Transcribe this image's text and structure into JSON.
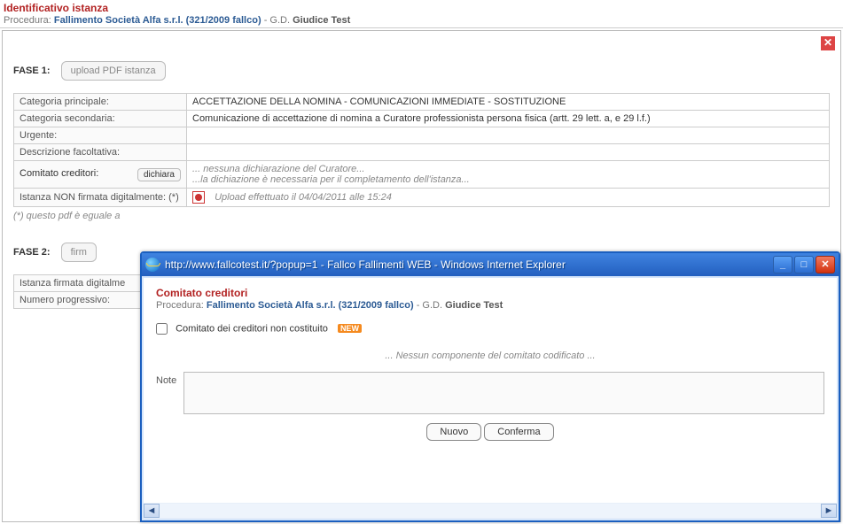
{
  "header": {
    "title": "Identificativo istanza",
    "proc_label": "Procedura:",
    "proc_value": "Fallimento Società Alfa s.r.l. (321/2009 fallco)",
    "gd_label": "- G.D.",
    "gd_value": "Giudice Test"
  },
  "fase1": {
    "label": "FASE 1:",
    "button": "upload PDF istanza"
  },
  "rows": {
    "cat_princ_lab": "Categoria principale:",
    "cat_princ_val": "ACCETTAZIONE DELLA NOMINA - COMUNICAZIONI IMMEDIATE - SOSTITUZIONE",
    "cat_sec_lab": "Categoria secondaria:",
    "cat_sec_val": "Comunicazione di accettazione di nomina a Curatore professionista persona fisica (artt. 29 lett. a, e 29 l.f.)",
    "urgente_lab": "Urgente:",
    "urgente_val": "",
    "descr_lab": "Descrizione facoltativa:",
    "descr_val": "",
    "comitato_lab": "Comitato creditori:",
    "comitato_btn": "dichiara",
    "comitato_txt1": "... nessuna dichiarazione del Curatore...",
    "comitato_txt2": "...la dichiazione è necessaria per il completamento dell'istanza...",
    "istanza_lab": "Istanza NON firmata digitalmente: (*)",
    "istanza_txt": "Upload effettuato il   04/04/2011 alle 15:24",
    "footnote": "(*) questo pdf è eguale a"
  },
  "fase2": {
    "label": "FASE 2:",
    "button": "firm"
  },
  "rows2": {
    "r1_lab": "Istanza firmata digitalme",
    "r2_lab": "Numero progressivo:"
  },
  "popup": {
    "title": "http://www.fallcotest.it/?popup=1 - Fallco Fallimenti WEB - Windows Internet Explorer",
    "section_title": "Comitato creditori",
    "proc_label": "Procedura:",
    "proc_value": "Fallimento Società Alfa s.r.l. (321/2009 fallco)",
    "gd_label": "- G.D.",
    "gd_value": "Giudice Test",
    "chk_label": "Comitato dei creditori non costituito",
    "new_badge": "NEW",
    "empty": "... Nessun componente del comitato codificato ...",
    "note_label": "Note",
    "btn_nuovo": "Nuovo",
    "btn_conferma": "Conferma"
  }
}
